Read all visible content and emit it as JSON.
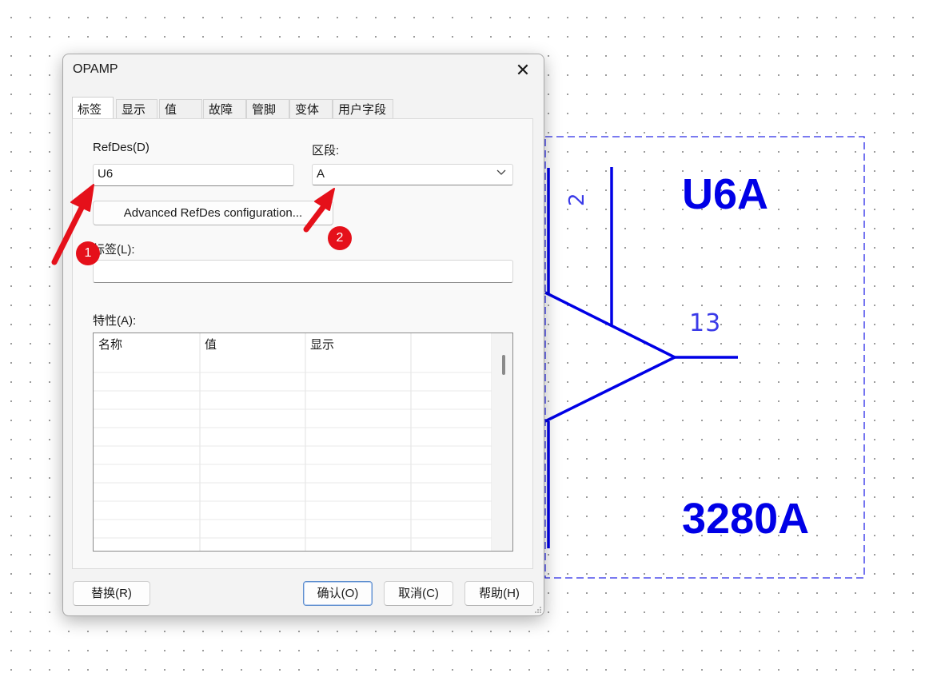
{
  "schematic": {
    "refdes": "U6A",
    "pin_top": "2",
    "pin_out": "13",
    "part_value": "3280A",
    "color": "#0000e6"
  },
  "dialog": {
    "title": "OPAMP",
    "close_icon": "close-icon",
    "tabs": [
      "标签",
      "显示",
      "值",
      "故障",
      "管脚",
      "变体",
      "用户字段"
    ],
    "active_tab": "标签",
    "refdes_label": "RefDes(D)",
    "refdes_value": "U6",
    "section_label": "区段:",
    "section_value": "A",
    "advanced_button": "Advanced RefDes configuration...",
    "tag_label": "标签(L):",
    "tag_value": "",
    "attributes_label": "特性(A):",
    "attributes_columns": [
      "名称",
      "值",
      "显示"
    ],
    "buttons": {
      "replace": "替换(R)",
      "ok": "确认(O)",
      "cancel": "取消(C)",
      "help": "帮助(H)"
    }
  },
  "annotations": [
    {
      "number": "1",
      "color": "#e5101a"
    },
    {
      "number": "2",
      "color": "#e5101a"
    }
  ]
}
